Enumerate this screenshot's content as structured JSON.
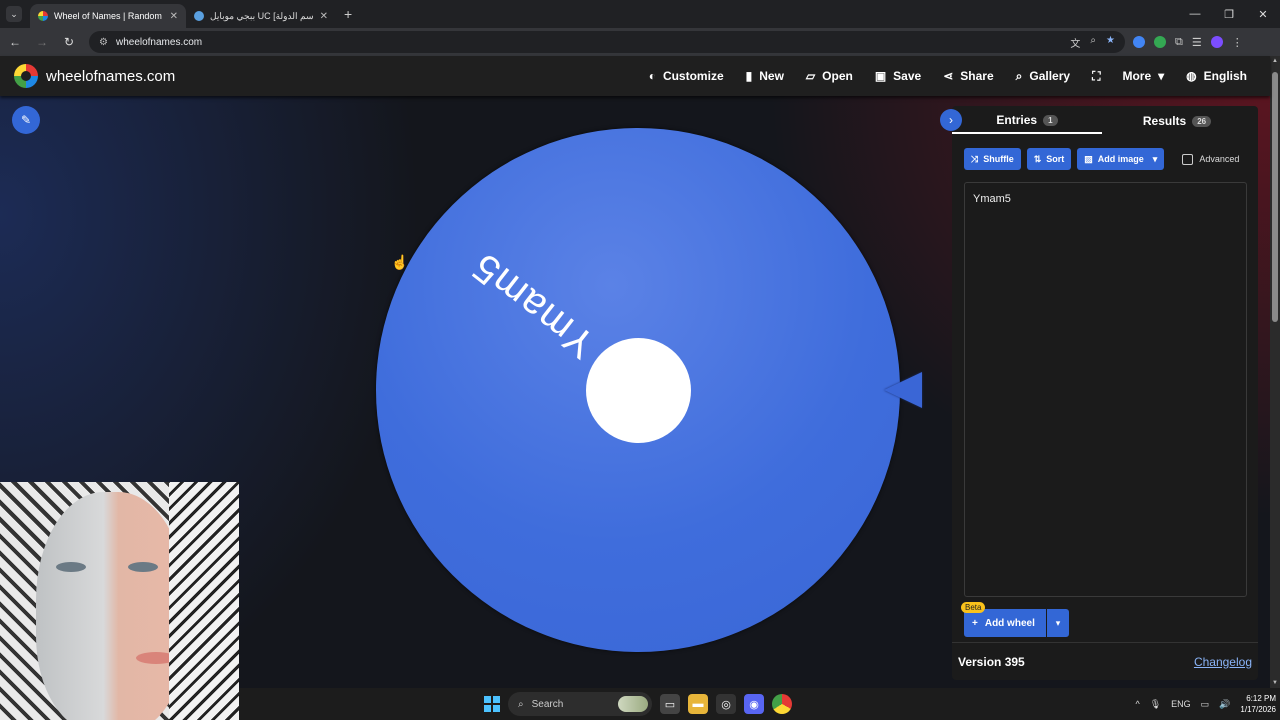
{
  "browser": {
    "tabs": [
      {
        "title": "Wheel of Names | Random nam",
        "active": true
      },
      {
        "title": "ببجي موبايل UC [اسم الدولة] | د...",
        "active": false
      }
    ],
    "url": "wheelofnames.com"
  },
  "app": {
    "brand": "wheelofnames.com",
    "menu": [
      {
        "icon": "palette-icon",
        "label": "Customize"
      },
      {
        "icon": "file-icon",
        "label": "New"
      },
      {
        "icon": "folder-open-icon",
        "label": "Open"
      },
      {
        "icon": "save-icon",
        "label": "Save"
      },
      {
        "icon": "share-icon",
        "label": "Share"
      },
      {
        "icon": "search-icon",
        "label": "Gallery"
      },
      {
        "icon": "fullscreen-icon",
        "label": ""
      },
      {
        "icon": "chevron-down-icon",
        "label": "More"
      },
      {
        "icon": "globe-icon",
        "label": "English"
      }
    ]
  },
  "wheel": {
    "segment_label": "Ymam5",
    "color": "#3f6ddc"
  },
  "panel": {
    "tab_entries": "Entries",
    "tab_entries_count": "1",
    "tab_results": "Results",
    "tab_results_count": "26",
    "shuffle": "Shuffle",
    "sort": "Sort",
    "add_image": "Add image",
    "advanced": "Advanced",
    "entries_text": "Ymam5",
    "add_wheel": "Add wheel",
    "beta": "Beta",
    "version": "Version 395",
    "changelog": "Changelog"
  },
  "taskbar": {
    "search": "Search",
    "lang": "ENG",
    "time": "6:12 PM",
    "date": "1/17/2026"
  }
}
